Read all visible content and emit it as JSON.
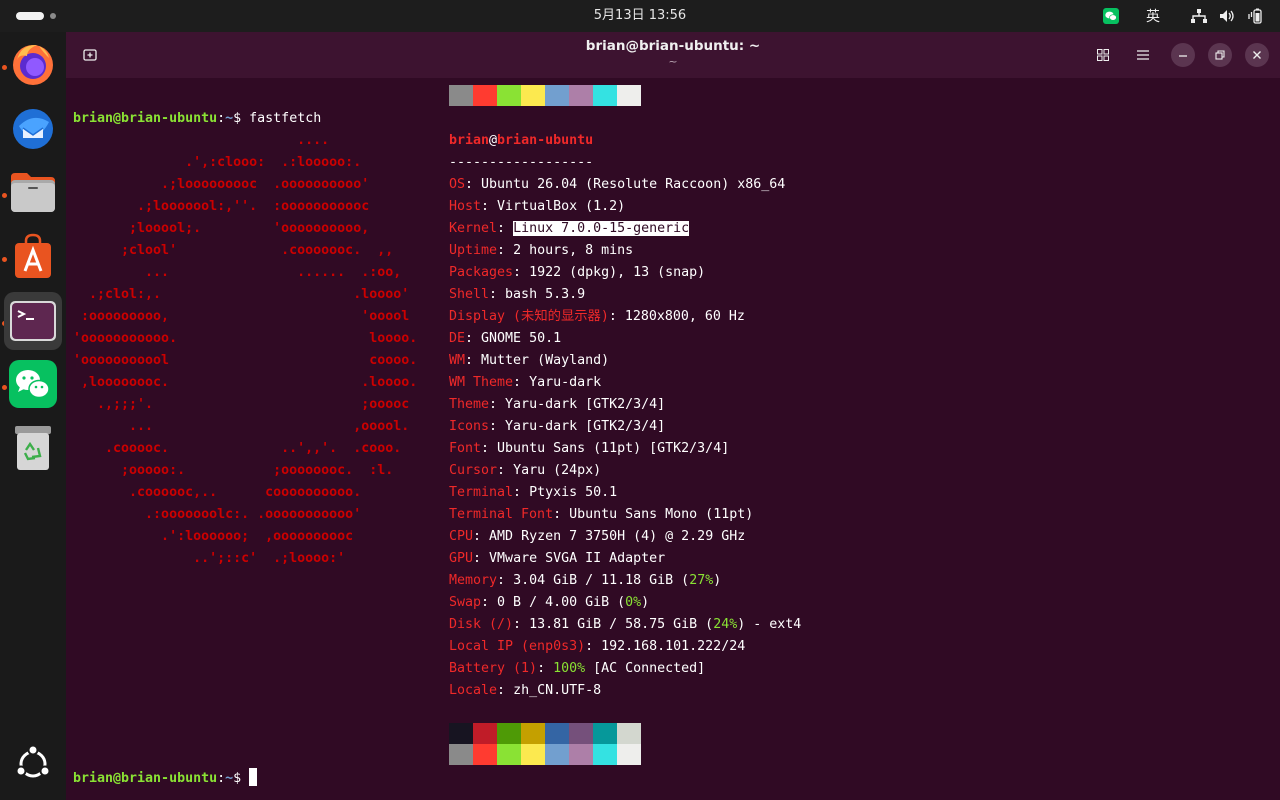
{
  "topbar": {
    "clock": "5月13日  13:56",
    "input_method": "英"
  },
  "dock": {
    "items": [
      {
        "name": "firefox",
        "running": true
      },
      {
        "name": "thunderbird",
        "running": false
      },
      {
        "name": "files",
        "running": true
      },
      {
        "name": "app-center",
        "running": true
      },
      {
        "name": "terminal",
        "running": true,
        "active": true
      },
      {
        "name": "wechat",
        "running": true
      },
      {
        "name": "trash",
        "running": false
      }
    ]
  },
  "window": {
    "title": "brian@brian-ubuntu: ~",
    "subtitle": "~"
  },
  "terminal": {
    "prompt_user": "brian@brian-ubuntu",
    "prompt_sep": ":",
    "prompt_path": "~",
    "prompt_symbol": "$",
    "command": " fastfetch",
    "logo_lines": [
      "                            ....",
      "              .',:clooo:  .:looooo:.",
      "           .;looooooooc  .oooooooooo'",
      "        .;looooool:,''.  :ooooooooooc",
      "       ;looool;.         'oooooooooo,",
      "      ;clool'             .cooooooc.  ,,",
      "         ...                ......  .:oo,",
      "  .;clol:,.                        .loooo'",
      " :ooooooooo,                        'ooool",
      "'ooooooooooo.                        loooo.",
      "'ooooooooool                         coooo.",
      " ,loooooooc.                        .loooo.",
      "   .,;;;'.                          ;ooooc",
      "       ...                         ,ooool.",
      "    .cooooc.              ..',,'.  .cooo.",
      "      ;ooooo:.           ;oooooooc.  :l.",
      "       .coooooc,..      coooooooooo.",
      "         .:ooooooolc:. .ooooooooooo'",
      "           .':loooooo;  ,oooooooooc",
      "               ..';::c'  .;loooo:'"
    ],
    "header_user": "brian",
    "header_at": "@",
    "header_host": "brian-ubuntu",
    "separator": "------------------",
    "info": [
      {
        "key": "OS",
        "value": "Ubuntu 26.04 (Resolute Raccoon) x86_64"
      },
      {
        "key": "Host",
        "value": "VirtualBox (1.2)"
      },
      {
        "key": "Kernel",
        "value": "Linux 7.0.0-15-generic"
      },
      {
        "key": "Uptime",
        "value": "2 hours, 8 mins"
      },
      {
        "key": "Packages",
        "value": "1922 (dpkg), 13 (snap)"
      },
      {
        "key": "Shell",
        "value": "bash 5.3.9"
      },
      {
        "key": "Display (未知的显示器)",
        "value": "1280x800, 60 Hz"
      },
      {
        "key": "DE",
        "value": "GNOME 50.1"
      },
      {
        "key": "WM",
        "value": "Mutter (Wayland)"
      },
      {
        "key": "WM Theme",
        "value": "Yaru-dark"
      },
      {
        "key": "Theme",
        "value": "Yaru-dark [GTK2/3/4]"
      },
      {
        "key": "Icons",
        "value": "Yaru-dark [GTK2/3/4]"
      },
      {
        "key": "Font",
        "value": "Ubuntu Sans (11pt) [GTK2/3/4]"
      },
      {
        "key": "Cursor",
        "value": "Yaru (24px)"
      },
      {
        "key": "Terminal",
        "value": "Ptyxis 50.1"
      },
      {
        "key": "Terminal Font",
        "value": "Ubuntu Sans Mono (11pt)"
      },
      {
        "key": "CPU",
        "value": "AMD Ryzen 7 3750H (4) @ 2.29 GHz"
      },
      {
        "key": "GPU",
        "value": "VMware SVGA II Adapter"
      },
      {
        "key": "Memory",
        "value": "3.04 GiB / 11.18 GiB (",
        "pct": "27%",
        "tail": ")"
      },
      {
        "key": "Swap",
        "value": "0 B / 4.00 GiB (",
        "pct": "0%",
        "tail": ")"
      },
      {
        "key": "Disk (/)",
        "value": "13.81 GiB / 58.75 GiB (",
        "pct": "24%",
        "tail": ") - ext4"
      },
      {
        "key": "Local IP (enp0s3)",
        "value": "192.168.101.222/24"
      },
      {
        "key": "Battery (1)",
        "value": "",
        "pct": "100%",
        "tail": " [AC Connected]"
      },
      {
        "key": "Locale",
        "value": "zh_CN.UTF-8"
      }
    ],
    "palette_top": [
      "#8a8a8a",
      "#ff3b30",
      "#8ae234",
      "#fce94f",
      "#729fcf",
      "#ad7fa8",
      "#34e2e2",
      "#eeeeec"
    ],
    "palette_dark": [
      "#171421",
      "#c01c28",
      "#4e9a06",
      "#c4a000",
      "#3465a4",
      "#75507b",
      "#06989a",
      "#d3d7cf"
    ],
    "palette_bright": [
      "#8a8a8a",
      "#ff3b30",
      "#8ae234",
      "#fce94f",
      "#729fcf",
      "#ad7fa8",
      "#34e2e2",
      "#eeeeec"
    ]
  },
  "colors": {
    "ubuntu_orange": "#e95420",
    "terminal_bg": "#300a24",
    "prompt_green": "#8ae234",
    "path_blue": "#729fcf",
    "logo_red": "#cc0000",
    "key_red": "#ef2929"
  }
}
